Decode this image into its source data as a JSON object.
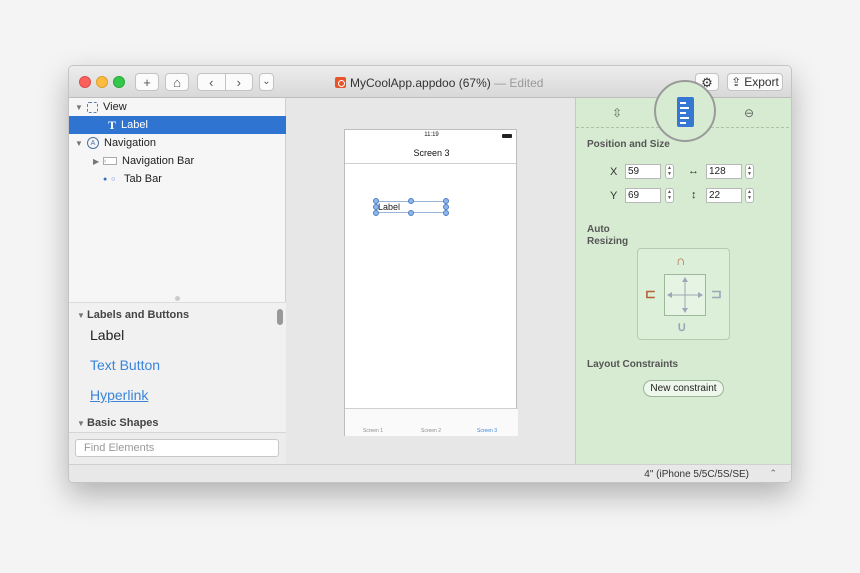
{
  "toolbar": {
    "add": "+",
    "home": "⌂",
    "back": "‹",
    "forward": "›",
    "menu": "⌄",
    "gear": "⚙",
    "export_label": "Export",
    "export_icon": "⇪"
  },
  "document": {
    "name": "MyCoolApp.appdoo (67%)",
    "status": "— Edited"
  },
  "tree": {
    "items": [
      {
        "label": "View"
      },
      {
        "label": "Label",
        "selected": true
      },
      {
        "label": "Navigation"
      },
      {
        "label": "Navigation Bar"
      },
      {
        "label": "Tab Bar"
      }
    ]
  },
  "library": {
    "section1": "Labels and Buttons",
    "label": "Label",
    "text_button": "Text Button",
    "hyperlink": "Hyperlink",
    "section2": "Basic Shapes",
    "search_placeholder": "Find Elements"
  },
  "canvas": {
    "time": "11:19",
    "screen_title": "Screen 3",
    "label_text": "Label",
    "tabs": [
      "Screen 1",
      "Screen 2",
      "Screen 3"
    ],
    "active_tab": 2
  },
  "inspector": {
    "position_title": "Position and Size",
    "x_label": "X",
    "x_value": "59",
    "w_icon": "↔",
    "w_value": "128",
    "y_label": "Y",
    "y_value": "69",
    "h_icon": "↕",
    "h_value": "22",
    "auto_resizing": "Auto\nResizing",
    "layout_constraints": "Layout Constraints",
    "new_constraint": "New constraint"
  },
  "footer": {
    "device": "4\" (iPhone 5/5C/5S/SE)",
    "chevron": "⌃⌄"
  },
  "colors": {
    "selection": "#2f74d0",
    "inspector_bg": "#d6ebd2",
    "accent": "#3a85d8"
  }
}
